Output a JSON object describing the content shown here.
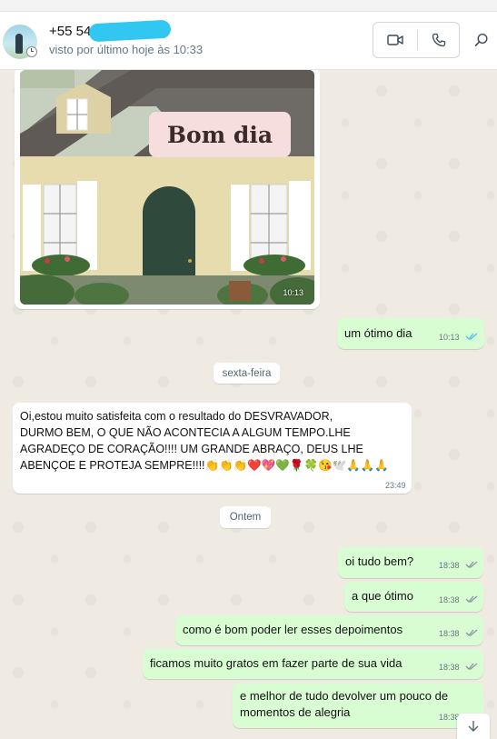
{
  "header": {
    "contact_name": "+55 54",
    "last_seen": "visto por último hoje às 10:33"
  },
  "icons": {
    "video": "video-camera-icon",
    "voice": "phone-icon",
    "search": "search-icon",
    "scroll": "chevron-down-icon"
  },
  "colors": {
    "incoming_bubble": "#ffffff",
    "outgoing_bubble": "#d9fdd3",
    "chat_background": "#efeae2",
    "read_ticks": "#53bdeb",
    "redaction": "#31c7f0"
  },
  "messages": {
    "image": {
      "caption": "Bom dia",
      "time": "10:13"
    },
    "m1": {
      "text": "um ótimo dia",
      "time": "10:13"
    },
    "day1": "sexta-feira",
    "m2": {
      "lines": [
        "Oi,estou muito satisfeita com o  resultado do DESVRAVADOR,",
        "DURMO BEM, O QUE NÃO  ACONTECIA A ALGUM TEMPO.LHE",
        "AGRADEÇO DE CORAÇÃO!!!! UM GRANDE ABRAÇO, DEUS LHE",
        "ABENÇOE E PROTEJA SEMPRE!!!!👏👏👏❤️💖💚🌹🍀😘🕊️🙏🙏🙏"
      ],
      "time": "23:49"
    },
    "day2": "Ontem",
    "m3": {
      "text": "oi tudo bem?",
      "time": "18:38"
    },
    "m4": {
      "text": "a que ótimo",
      "time": "18:38"
    },
    "m5": {
      "text": "como é bom poder ler esses depoimentos",
      "time": "18:38"
    },
    "m6": {
      "text": "ficamos muito gratos em fazer parte de sua vida",
      "time": "18:38"
    },
    "m7": {
      "lines": [
        "e melhor de tudo devolver um pouco de",
        "momentos de alegria"
      ],
      "time": "18:38"
    }
  }
}
